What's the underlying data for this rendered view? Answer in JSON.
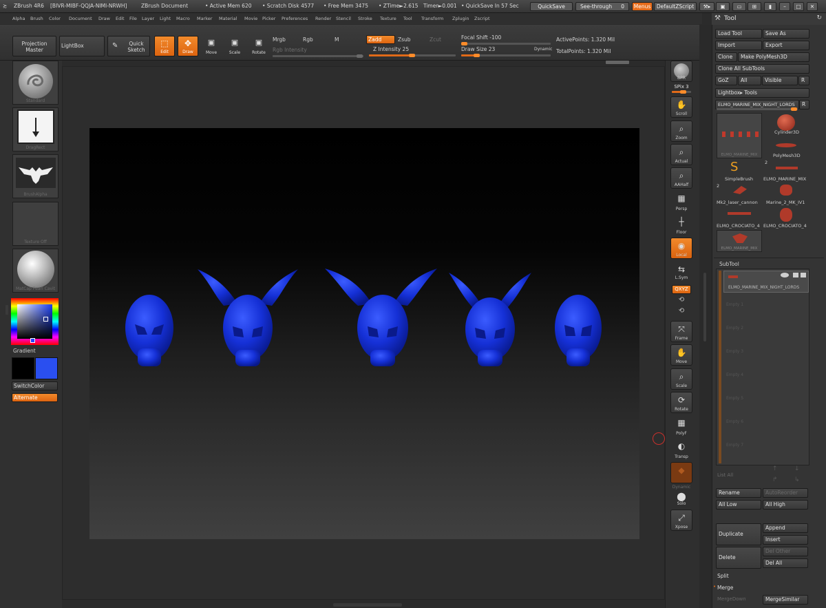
{
  "titlebar": {
    "app": "ZBrush 4R6",
    "key": "[BIVR-MIBF-QQJA-NIMI-NRWH]",
    "doc": "ZBrush Document",
    "active_mem": "• Active Mem 620",
    "scratch": "• Scratch Disk 4577",
    "free_mem": "• Free Mem 3475",
    "ztime": "• ZTime►2.615",
    "timer": "Timer►0.001",
    "quicksave_in": "• QuickSave In 57 Sec",
    "quicksave": "QuickSave",
    "seethrough": "See-through",
    "seethrough_val": "0",
    "menus": "Menus",
    "script": "DefaultZScript"
  },
  "menu": [
    "Alpha",
    "Brush",
    "Color",
    "Document",
    "Draw",
    "Edit",
    "File",
    "Layer",
    "Light",
    "Macro",
    "Marker",
    "Material",
    "Movie",
    "Picker",
    "Preferences",
    "Render",
    "Stencil",
    "Stroke",
    "Texture",
    "Tool",
    "Transform",
    "Zplugin",
    "Zscript"
  ],
  "shelf": {
    "projection": "Projection Master",
    "lightbox": "LightBox",
    "quicksketch": "Quick Sketch",
    "edit": "Edit",
    "draw": "Draw",
    "move": "Move",
    "scale": "Scale",
    "rotate": "Rotate",
    "mrgb": "Mrgb",
    "rgb": "Rgb",
    "m": "M",
    "rgb_intensity": "Rgb Intensity",
    "zadd": "Zadd",
    "zsub": "Zsub",
    "zcut": "Zcut",
    "z_intensity": "Z Intensity 25",
    "focal_shift": "Focal Shift -100",
    "draw_size": "Draw Size 23",
    "dynamic": "Dynamic",
    "active_points": "ActivePoints: 1.320 Mil",
    "total_points": "TotalPoints: 1.320 Mil"
  },
  "left": {
    "brush": "Standard",
    "stroke": "DragRect",
    "alpha": "BrushAlpha",
    "texture": "Texture Off",
    "material": "MatCap Pearl Cavit",
    "gradient": "Gradient",
    "switchcolor": "SwitchColor",
    "alternate": "Alternate",
    "primary_color": "#000000",
    "secondary_color": "#2a4ff0"
  },
  "right": {
    "bpr": "BPR",
    "spix": "SPix 3",
    "scroll": "Scroll",
    "zoom": "Zoom",
    "actual": "Actual",
    "aahalf": "AAHalf",
    "persp": "Persp",
    "floor": "Floor",
    "local": "Local",
    "lsym": "L.Sym",
    "qxyz": "QXYZ",
    "frame": "Frame",
    "move": "Move",
    "scale": "Scale",
    "rotate": "Rotate",
    "polyf": "PolyF",
    "transp": "Transp",
    "dynamic": "Dynamic",
    "solo": "Solo",
    "xpose": "Xpose"
  },
  "tool": {
    "title": "Tool",
    "load_tool": "Load Tool",
    "save_as": "Save As",
    "import": "Import",
    "export": "Export",
    "clone": "Clone",
    "make_polymesh": "Make PolyMesh3D",
    "clone_all": "Clone All SubTools",
    "goz": "GoZ",
    "all": "All",
    "visible": "Visible",
    "r": "R",
    "lightbox_tools": "Lightbox▸ Tools",
    "current_tool": "ELMO_MARINE_MIX_NIGHT_LORDS",
    "current_r": "R",
    "items": [
      {
        "name": "Cylinder3D"
      },
      {
        "name": "PolyMesh3D"
      },
      {
        "name": "SimpleBrush"
      },
      {
        "name": "ELMO_MARINE_MIX"
      },
      {
        "name": "Mk2_laser_cannon"
      },
      {
        "name": "Marine_2_MK_IV1"
      },
      {
        "name": "ELMO_CROCIATO_4"
      },
      {
        "name": "ELMO_CROCIATO_4"
      },
      {
        "name": "ELMO_MARINE_MIX"
      }
    ],
    "count_2a": "2",
    "count_2b": "2",
    "thumb_label": "ELMO_MARINE_MIX",
    "subtool": "SubTool",
    "subtool_first": "ELMO_MARINE_MIX_NIGHT_LORDS",
    "subtool_empty": [
      "Empty 1",
      "Empty 2",
      "Empty 3",
      "Empty 4",
      "Empty 5",
      "Empty 6",
      "Empty 7"
    ],
    "list_all": "List All",
    "rename": "Rename",
    "autoreorder": "AutoReorder",
    "all_low": "All Low",
    "all_high": "All High",
    "duplicate": "Duplicate",
    "append": "Append",
    "insert": "Insert",
    "delete": "Delete",
    "del_other": "Del Other",
    "del_all": "Del All",
    "split": "Split",
    "merge": "Merge",
    "merge_down": "MergeDown",
    "merge_similar": "MergeSimilar"
  }
}
